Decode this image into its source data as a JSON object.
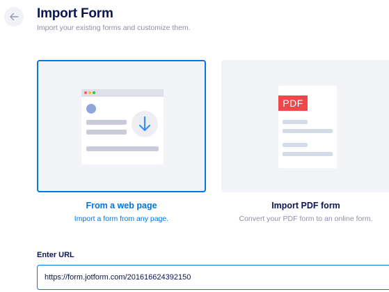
{
  "header": {
    "back_icon": "arrow-left-icon",
    "title": "Import Form",
    "subtitle": "Import your existing forms and customize them."
  },
  "options": [
    {
      "id": "web",
      "title": "From a web page",
      "description": "Import a form from any page.",
      "selected": true,
      "icon": "download-arrow-icon"
    },
    {
      "id": "pdf",
      "title": "Import PDF form",
      "description": "Convert your PDF form to an online form.",
      "selected": false,
      "badge_text": "PDF"
    }
  ],
  "url_field": {
    "label": "Enter URL",
    "value": "https://form.jotform.com/201616624392150"
  },
  "colors": {
    "accent": "#0075e3",
    "title": "#0a1551",
    "muted": "#8d8fa8",
    "pdf_red": "#f0474b",
    "card_bg": "#f3f4f8"
  }
}
